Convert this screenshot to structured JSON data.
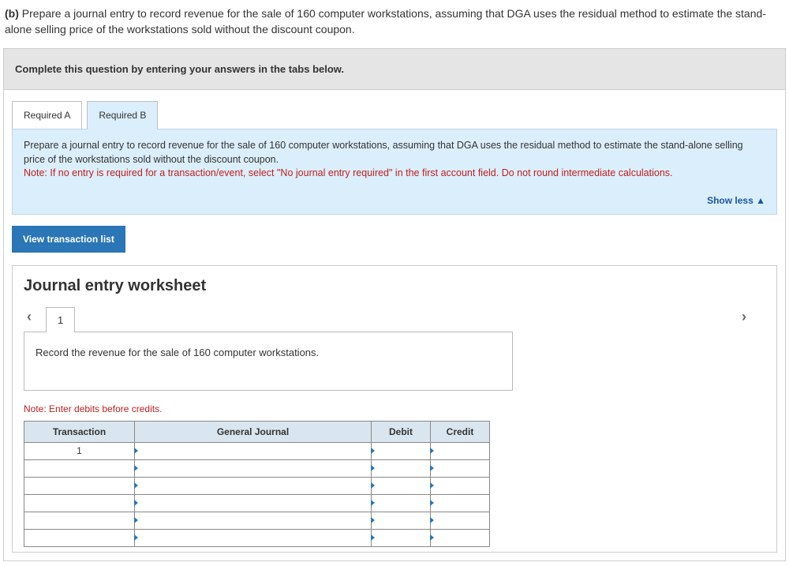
{
  "question": {
    "label": "(b)",
    "text": "Prepare a journal entry to record revenue for the sale of 160 computer workstations, assuming that DGA uses the residual method to estimate the stand-alone selling price of the workstations sold without the discount coupon."
  },
  "instruction": "Complete this question by entering your answers in the tabs below.",
  "tabs": [
    {
      "label": "Required A",
      "active": false
    },
    {
      "label": "Required B",
      "active": true
    }
  ],
  "panel": {
    "desc": "Prepare a journal entry to record revenue for the sale of 160 computer workstations, assuming that DGA uses the residual method to estimate the stand-alone selling price of the workstations sold without the discount coupon.",
    "note": "Note: If no entry is required for a transaction/event, select \"No journal entry required\" in the first account field. Do not round intermediate calculations.",
    "show_less": "Show less"
  },
  "view_transaction_button": "View transaction list",
  "worksheet": {
    "title": "Journal entry worksheet",
    "page": "1",
    "record_text": "Record the revenue for the sale of 160 computer workstations.",
    "credits_note": "Note: Enter debits before credits.",
    "headers": {
      "transaction": "Transaction",
      "general_journal": "General Journal",
      "debit": "Debit",
      "credit": "Credit"
    },
    "first_transaction": "1"
  }
}
